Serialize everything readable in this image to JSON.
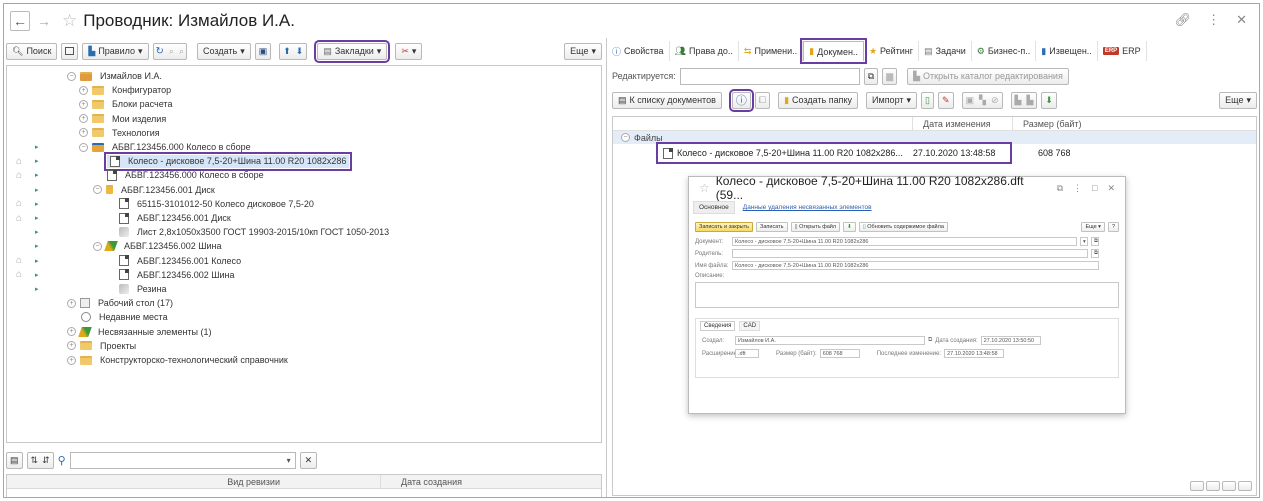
{
  "window": {
    "title": "Проводник: Измайлов И.А."
  },
  "left_toolbar": {
    "search": "Поиск",
    "rule": "Правило",
    "create": "Создать",
    "bookmarks": "Закладки",
    "more": "Еще"
  },
  "tree": [
    {
      "label": "Измайлов И.А.",
      "depth": 0,
      "expander": "⊖",
      "icon": "user"
    },
    {
      "label": "Конфигуратор",
      "depth": 1,
      "expander": "⊕",
      "icon": "folder"
    },
    {
      "label": "Блоки расчета",
      "depth": 1,
      "expander": "⊕",
      "icon": "folder"
    },
    {
      "label": "Мои изделия",
      "depth": 1,
      "expander": "⊕",
      "icon": "folder"
    },
    {
      "label": "Технология",
      "depth": 1,
      "expander": "⊕",
      "icon": "folder"
    },
    {
      "label": "АБВГ.123456.000 Колесо в сборе",
      "depth": 1,
      "expander": "⊖",
      "icon": "assembly",
      "tri": true
    },
    {
      "label": "Колесо - дисковое 7,5-20+Шина 11.00 R20 1082x286",
      "depth": 2,
      "icon": "doc",
      "tri": true,
      "lock": true,
      "selected": true
    },
    {
      "label": "АБВГ.123456.000 Колесо в сборе",
      "depth": 2,
      "icon": "doc",
      "tri": true,
      "lock": true
    },
    {
      "label": "АБВГ.123456.001 Диск",
      "depth": 2,
      "expander": "⊖",
      "icon": "part",
      "tri": true
    },
    {
      "label": "65115-3101012-50 Колесо дисковое 7,5-20",
      "depth": 3,
      "icon": "doc",
      "tri": true,
      "lock": true
    },
    {
      "label": "АБВГ.123456.001 Диск",
      "depth": 3,
      "icon": "doc",
      "tri": true,
      "lock": true
    },
    {
      "label": "Лист 2,8x1050x3500 ГОСТ 19903-2015/10кп ГОСТ 1050-2013",
      "depth": 3,
      "icon": "material",
      "tri": true
    },
    {
      "label": "АБВГ.123456.002 Шина",
      "depth": 2,
      "expander": "⊖",
      "icon": "pen",
      "tri": true
    },
    {
      "label": "АБВГ.123456.001 Колесо",
      "depth": 3,
      "icon": "doc",
      "tri": true,
      "lock": true
    },
    {
      "label": "АБВГ.123456.002 Шина",
      "depth": 3,
      "icon": "doc",
      "tri": true,
      "lock": true
    },
    {
      "label": "Резина",
      "depth": 3,
      "icon": "material",
      "tri": true
    },
    {
      "label": "Рабочий стол (17)",
      "depth": 0,
      "expander": "⊕",
      "icon": "desk"
    },
    {
      "label": "Недавние места",
      "depth": 0,
      "icon": "clock"
    },
    {
      "label": "Несвязанные элементы (1)",
      "depth": 0,
      "expander": "⊕",
      "icon": "pen"
    },
    {
      "label": "Проекты",
      "depth": 0,
      "expander": "⊕",
      "icon": "folder"
    },
    {
      "label": "Конструкторско-технологический справочник",
      "depth": 0,
      "expander": "⊕",
      "icon": "folder"
    }
  ],
  "bottom_grid": {
    "col1": "Вид ревизии",
    "col2": "Дата создания"
  },
  "tabs": [
    {
      "label": "Свойства"
    },
    {
      "label": "Права до.."
    },
    {
      "label": "Примени.."
    },
    {
      "label": "Докумен..",
      "active": true
    },
    {
      "label": "Рейтинг"
    },
    {
      "label": "Задачи"
    },
    {
      "label": "Бизнес-п.."
    },
    {
      "label": "Извещен.."
    },
    {
      "label": "ERP",
      "badge": "ERP"
    }
  ],
  "edit_bar": {
    "label": "Редактируется:",
    "open_catalog": "Открыть каталог редактирования"
  },
  "docs_toolbar": {
    "to_list": "К списку документов",
    "create_folder": "Создать папку",
    "import": "Импорт",
    "more": "Еще"
  },
  "files_table": {
    "col_date": "Дата изменения",
    "col_size": "Размер (байт)",
    "group": "Файлы",
    "row": {
      "name": "Колесо - дисковое 7,5-20+Шина 11.00 R20 1082x286...",
      "date": "27.10.2020 13:48:58",
      "size": "608 768"
    }
  },
  "dialog": {
    "title": "Колесо - дисковое 7,5-20+Шина 11.00 R20 1082x286.dft (59...",
    "tab_main": "Основное",
    "tab_link": "Данные удаления несвязанных элементов",
    "btn_save_close": "Записать и закрыть",
    "btn_save": "Записать",
    "btn_open": "Открыть файл",
    "btn_refresh": "Обновить содержимое файла",
    "btn_more": "Еще",
    "btn_help": "?",
    "lbl_document": "Документ:",
    "val_document": "Колесо - дисковое 7,5-20+Шина 11.00 R20 1082х286",
    "lbl_parent": "Родитель:",
    "lbl_filename": "Имя файла:",
    "val_filename": "Колесо - дисковое 7,5-20+Шина 11.00 R20 1082х286",
    "lbl_desc": "Описание:",
    "sub_tab1": "Сведения",
    "sub_tab2": "CAD",
    "lbl_created": "Создал:",
    "val_created": "Измайлов И.А.",
    "lbl_create_date": "Дата создания:",
    "val_create_date": "27.10.2020 13:50:50",
    "lbl_ext": "Расширение:",
    "val_ext": ".dft",
    "lbl_size": "Размер (байт):",
    "val_size": "608 768",
    "lbl_last": "Последнее изменение:",
    "val_last": "27.10.2020 13:48:58"
  }
}
